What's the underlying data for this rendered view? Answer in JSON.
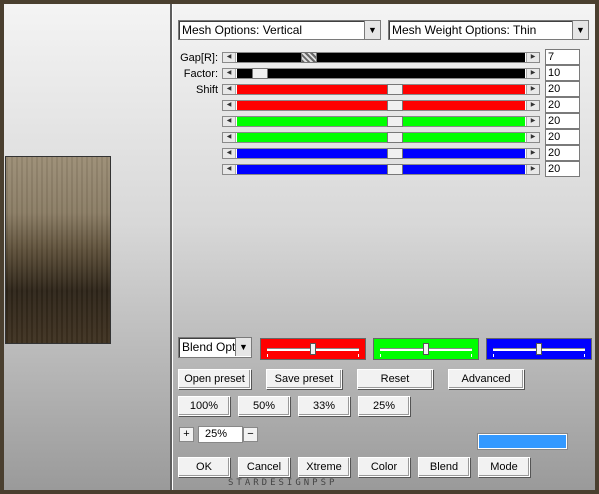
{
  "dropdowns": {
    "mesh_options": "Mesh Options: Vertical",
    "mesh_weight": "Mesh Weight Options: Thin",
    "blend_options": "Blend Options"
  },
  "labels": {
    "gap": "Gap[R]:",
    "factor": "Factor:",
    "shift": "Shift"
  },
  "sliders": [
    {
      "name": "gap",
      "value": "7",
      "position": 0.25,
      "color": "#000000"
    },
    {
      "name": "factor",
      "value": "10",
      "position": 0.08,
      "color": "#000000"
    },
    {
      "name": "shift-red-1",
      "value": "20",
      "position": 0.55,
      "color": "#ff0000"
    },
    {
      "name": "shift-red-2",
      "value": "20",
      "position": 0.55,
      "color": "#ff0000"
    },
    {
      "name": "shift-green-1",
      "value": "20",
      "position": 0.55,
      "color": "#00ff00"
    },
    {
      "name": "shift-green-2",
      "value": "20",
      "position": 0.55,
      "color": "#00ff00"
    },
    {
      "name": "shift-blue-1",
      "value": "20",
      "position": 0.55,
      "color": "#0000ff"
    },
    {
      "name": "shift-blue-2",
      "value": "20",
      "position": 0.55,
      "color": "#0000ff"
    }
  ],
  "color_sliders": [
    {
      "name": "red",
      "color": "#ff0000",
      "position": 0.5
    },
    {
      "name": "green",
      "color": "#00ff00",
      "position": 0.5
    },
    {
      "name": "blue",
      "color": "#0000ff",
      "position": 0.5
    }
  ],
  "buttons": {
    "open_preset": "Open preset",
    "save_preset": "Save preset",
    "reset": "Reset",
    "advanced": "Advanced",
    "zoom_100": "100%",
    "zoom_50": "50%",
    "zoom_33": "33%",
    "zoom_25": "25%",
    "plus": "+",
    "minus": "−",
    "ok": "OK",
    "cancel": "Cancel",
    "xtreme": "Xtreme",
    "color": "Color",
    "blend": "Blend",
    "mode": "Mode"
  },
  "zoom_value": "25%",
  "swatch_color": "#3399ff",
  "watermark": "STARDESIGNPSP"
}
